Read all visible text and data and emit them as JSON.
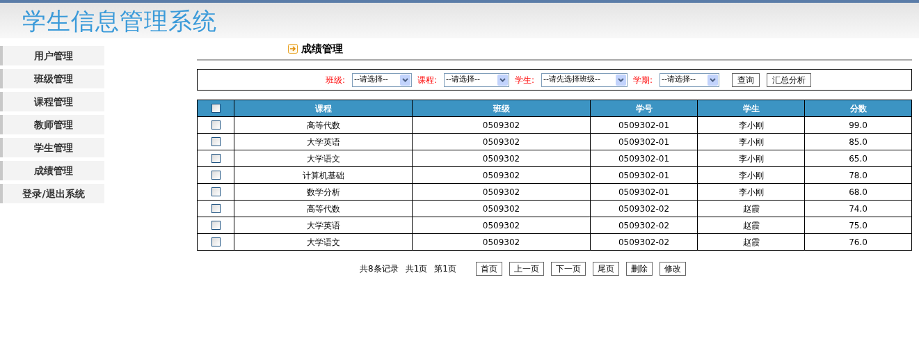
{
  "header": {
    "title": "学生信息管理系统"
  },
  "sidebar": {
    "items": [
      {
        "label": "用户管理"
      },
      {
        "label": "班级管理"
      },
      {
        "label": "课程管理"
      },
      {
        "label": "教师管理"
      },
      {
        "label": "学生管理"
      },
      {
        "label": "成绩管理"
      },
      {
        "label": "登录/退出系统"
      }
    ]
  },
  "page_title": "成绩管理",
  "filters": [
    {
      "label": "班级:",
      "value": "--请选择--"
    },
    {
      "label": "课程:",
      "value": "--请选择--"
    },
    {
      "label": "学生:",
      "value": "--请先选择班级--"
    },
    {
      "label": "学期:",
      "value": "--请选择--"
    }
  ],
  "filter_buttons": [
    "查询",
    "汇总分析"
  ],
  "table": {
    "header_checked": false,
    "columns": [
      "课程",
      "班级",
      "学号",
      "学生",
      "分数"
    ],
    "rows": [
      {
        "checked": false,
        "cells": [
          "高等代数",
          "0509302",
          "0509302-01",
          "李小刚",
          "99.0"
        ]
      },
      {
        "checked": false,
        "cells": [
          "大学英语",
          "0509302",
          "0509302-01",
          "李小刚",
          "85.0"
        ]
      },
      {
        "checked": false,
        "cells": [
          "大学语文",
          "0509302",
          "0509302-01",
          "李小刚",
          "65.0"
        ]
      },
      {
        "checked": false,
        "cells": [
          "计算机基础",
          "0509302",
          "0509302-01",
          "李小刚",
          "78.0"
        ]
      },
      {
        "checked": false,
        "cells": [
          "数学分析",
          "0509302",
          "0509302-01",
          "李小刚",
          "68.0"
        ]
      },
      {
        "checked": false,
        "cells": [
          "高等代数",
          "0509302",
          "0509302-02",
          "赵霞",
          "74.0"
        ]
      },
      {
        "checked": false,
        "cells": [
          "大学英语",
          "0509302",
          "0509302-02",
          "赵霞",
          "75.0"
        ]
      },
      {
        "checked": false,
        "cells": [
          "大学语文",
          "0509302",
          "0509302-02",
          "赵霞",
          "76.0"
        ]
      }
    ]
  },
  "pagination": {
    "info": [
      "共8条记录",
      "共1页",
      "第1页"
    ],
    "buttons": [
      "首页",
      "上一页",
      "下一页",
      "尾页",
      "删除",
      "修改"
    ]
  }
}
